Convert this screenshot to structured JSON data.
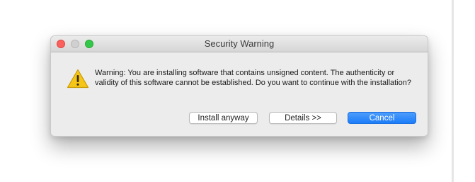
{
  "dialog": {
    "title": "Security Warning",
    "icon": "warning-icon",
    "message": "Warning: You are installing software that contains unsigned content. The authenticity or validity of this software cannot be established. Do you want to continue with the installation?",
    "buttons": {
      "install": "Install anyway",
      "details": "Details >>",
      "cancel": "Cancel"
    }
  },
  "colors": {
    "accent": "#1c7cf9",
    "warning_fill": "#f5c518",
    "close": "#fc605c",
    "zoom": "#34c84a"
  }
}
